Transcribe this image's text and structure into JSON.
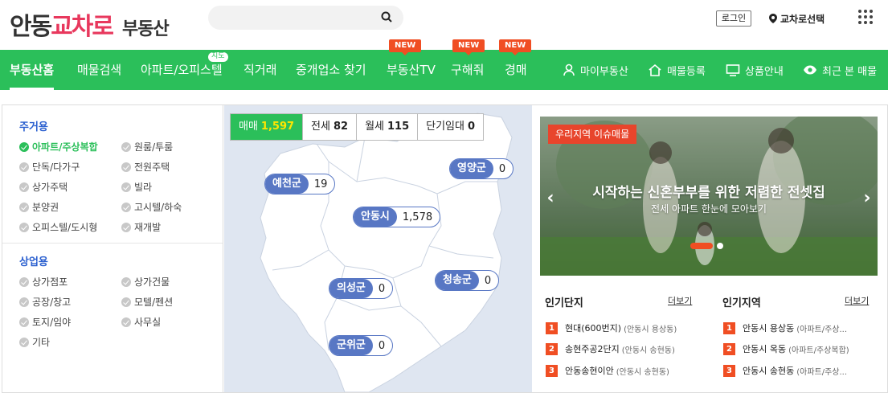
{
  "header": {
    "logo_part1": "안동",
    "logo_part2": "교차로",
    "logo_part3": "부동산",
    "search_placeholder": "",
    "login_label": "로그인",
    "region_label": "교차로선택"
  },
  "nav": {
    "items": [
      {
        "label": "부동산홈"
      },
      {
        "label": "매물검색"
      },
      {
        "label": "아파트/오피스텔",
        "badge": "지도"
      },
      {
        "label": "직거래"
      },
      {
        "label": "중개업소 찾기"
      },
      {
        "label": "부동산TV",
        "badge": "NEW"
      },
      {
        "label": "구해줘",
        "badge": "NEW"
      },
      {
        "label": "경매",
        "badge": "NEW"
      }
    ],
    "right": [
      {
        "label": "마이부동산",
        "icon": "person-icon"
      },
      {
        "label": "매물등록",
        "icon": "house-icon"
      },
      {
        "label": "상품안내",
        "icon": "monitor-icon"
      },
      {
        "label": "최근 본 매물",
        "icon": "eye-icon"
      }
    ]
  },
  "categories": {
    "residential_title": "주거용",
    "residential": [
      {
        "label": "아파트/주상복합",
        "selected": true
      },
      {
        "label": "원룸/투룸"
      },
      {
        "label": "단독/다가구"
      },
      {
        "label": "전원주택"
      },
      {
        "label": "상가주택"
      },
      {
        "label": "빌라"
      },
      {
        "label": "분양권"
      },
      {
        "label": "고시텔/하숙"
      },
      {
        "label": "오피스텔/도시형"
      },
      {
        "label": "재개발"
      }
    ],
    "commercial_title": "상업용",
    "commercial": [
      {
        "label": "상가점포"
      },
      {
        "label": "상가건물"
      },
      {
        "label": "공장/창고"
      },
      {
        "label": "모텔/펜션"
      },
      {
        "label": "토지/임야"
      },
      {
        "label": "사무실"
      },
      {
        "label": "기타"
      }
    ]
  },
  "map": {
    "tabs": [
      {
        "label": "매매",
        "count": "1,597"
      },
      {
        "label": "전세",
        "count": "82"
      },
      {
        "label": "월세",
        "count": "115"
      },
      {
        "label": "단기임대",
        "count": "0"
      }
    ],
    "regions": [
      {
        "name": "예천군",
        "count": "19"
      },
      {
        "name": "영양군",
        "count": "0"
      },
      {
        "name": "안동시",
        "count": "1,578"
      },
      {
        "name": "청송군",
        "count": "0"
      },
      {
        "name": "의성군",
        "count": "0"
      },
      {
        "name": "군위군",
        "count": "0"
      }
    ]
  },
  "banner": {
    "tag": "우리지역 이슈매물",
    "title": "시작하는 신혼부부를 위한 저렴한 전셋집",
    "subtitle": "전세 아파트 한눈에 모아보기",
    "prev": "‹",
    "next": "›"
  },
  "popular_complex": {
    "title": "인기단지",
    "more": "더보기",
    "items": [
      {
        "rank": "1",
        "name": "현대(600번지)",
        "sub": "(안동시 용상동)"
      },
      {
        "rank": "2",
        "name": "송현주공2단지",
        "sub": "(안동시 송현동)"
      },
      {
        "rank": "3",
        "name": "안동송현이안",
        "sub": "(안동시 송현동)"
      }
    ]
  },
  "popular_region": {
    "title": "인기지역",
    "more": "더보기",
    "items": [
      {
        "rank": "1",
        "name": "안동시 용상동",
        "sub": "(아파트/주상..."
      },
      {
        "rank": "2",
        "name": "안동시 옥동",
        "sub": "(아파트/주상복합)"
      },
      {
        "rank": "3",
        "name": "안동시 송현동",
        "sub": "(아파트/주상..."
      }
    ]
  },
  "colors": {
    "brand_green": "#2bbf5a",
    "logo_pink": "#e8385d",
    "badge_red": "#f04e23",
    "link_blue": "#2a5fcf",
    "pin_blue": "#5877c4"
  }
}
